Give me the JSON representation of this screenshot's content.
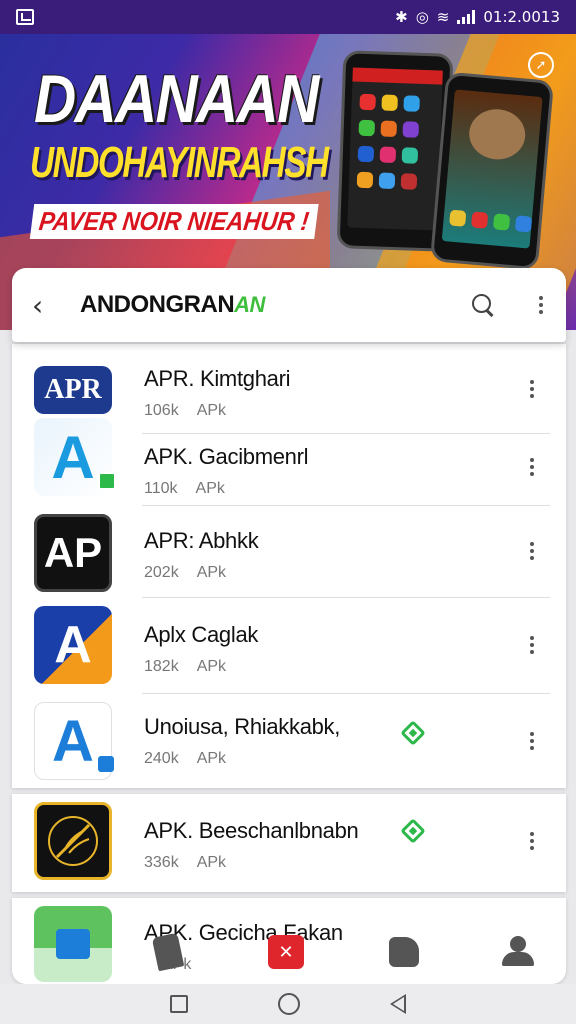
{
  "status_bar": {
    "time": "01:2.0013"
  },
  "banner": {
    "title": "DAANAAN",
    "subtitle": "UNDOHAYINRAHSH",
    "tagline": "PAVER NOIR NIEAHUR !"
  },
  "app_bar": {
    "title": "ANDONGRAN",
    "title_accent": "AN"
  },
  "apps": [
    {
      "name": "APR. Kimtghari",
      "size": "106k",
      "type": "APk",
      "icon_text": "APR",
      "colors": [
        "#1d3a8f",
        "#ffffff"
      ]
    },
    {
      "name": "APK. Gacibmenrl",
      "size": "110k",
      "type": "APk",
      "icon_text": "A",
      "colors": [
        "#1a9be0",
        "#ffffff"
      ]
    },
    {
      "name": "APR: Abhkk",
      "size": "202k",
      "type": "APk",
      "icon_text": "AP",
      "colors": [
        "#111111",
        "#ffffff"
      ]
    },
    {
      "name": "Aplx Caglak",
      "size": "182k",
      "type": "APk",
      "icon_text": "A",
      "colors": [
        "#1b3fa8",
        "#f39a1a"
      ]
    },
    {
      "name": "Unoiusa, Rhiakkabk,",
      "size": "240k",
      "type": "APk",
      "icon_text": "A",
      "colors": [
        "#ffffff",
        "#1c7ed8"
      ]
    },
    {
      "name": "APK. Beeschanlbnabn",
      "size": "336k",
      "type": "APk",
      "icon_text": "",
      "colors": [
        "#111111",
        "#e8b52a"
      ]
    },
    {
      "name": "APK. Gecicha Fakan",
      "size": "",
      "type": "APk",
      "icon_text": "",
      "colors": [
        "#5ec25e",
        "#ffffff"
      ]
    }
  ],
  "icons": {
    "back": "back-arrow-icon",
    "search": "search-icon",
    "more": "more-vertical-icon",
    "verified": "verified-badge-icon"
  },
  "colors": {
    "accent": "#3dbf3d",
    "status_bar": "#3a1d7a",
    "badge": "#2db84a",
    "nav_red": "#e0262d"
  }
}
